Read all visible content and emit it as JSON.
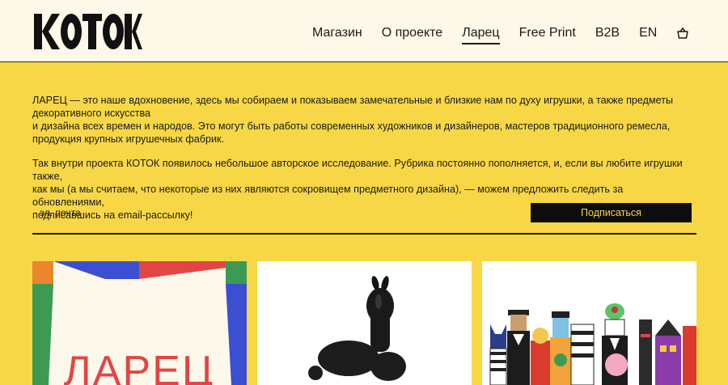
{
  "header": {
    "logo_text": "КОТОК",
    "nav": [
      {
        "label": "Магазин",
        "active": false
      },
      {
        "label": "О проекте",
        "active": false
      },
      {
        "label": "Ларец",
        "active": true
      },
      {
        "label": "Free Print",
        "active": false
      },
      {
        "label": "B2B",
        "active": false
      },
      {
        "label": "EN",
        "active": false
      }
    ],
    "cart_icon": "shopping-bag-icon"
  },
  "intro": {
    "p1_line1": "ЛАРЕЦ — это наше вдохновение, здесь мы собираем и показываем замечательные и близкие нам по духу игрушки, а также предметы",
    "p1_line2": "декоративного искусства",
    "p1_line3": "и дизайна всех времен и народов. Это могут быть работы современных художников и дизайнеров, мастеров традиционного ремесла,",
    "p1_line4": "продукция крупных игрушечных фабрик.",
    "p2_line1": "Так внутри проекта КОТОК появилось небольшое авторское исследование. Рубрика постоянно пополняется, и, если вы любите игрушки также,",
    "p2_line2": "как мы (а мы считаем, что некоторые из них являются сокровищем предметного дизайна), — можем предложить следить за обновлениями,",
    "p2_line3": "подписавшись на email-рассылку!"
  },
  "subscribe": {
    "email_placeholder": "эл. почта",
    "button_label": "Подписаться"
  },
  "cards": [
    {
      "title_text": "ЛАРЕЦ",
      "image": "colorful-banner"
    },
    {
      "image": "black-toy-figure"
    },
    {
      "image": "toy-figurines-group"
    }
  ],
  "colors": {
    "background": "#f8d746",
    "header_bg": "#fdf8e8",
    "button_bg": "#0d0d0d",
    "button_text": "#f8d746"
  }
}
